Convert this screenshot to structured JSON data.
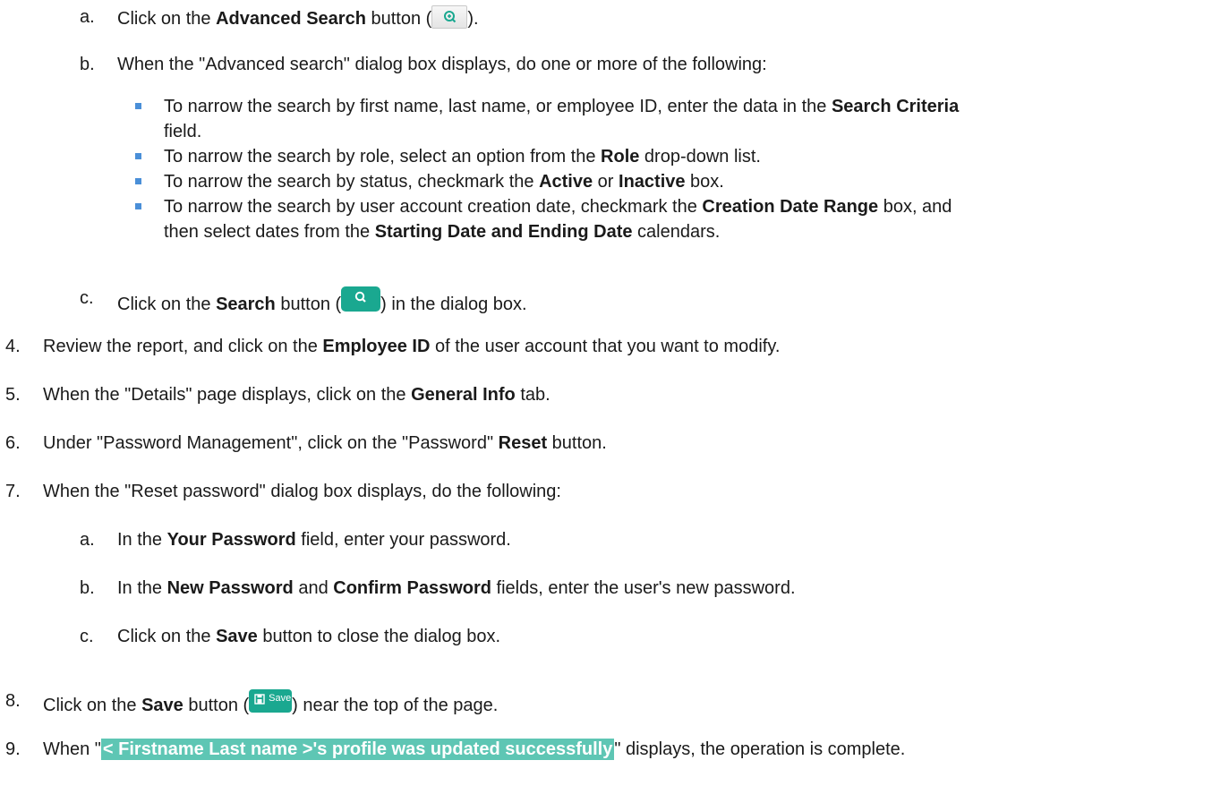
{
  "steps": {
    "a_top": {
      "marker": "a.",
      "pre": "Click on the ",
      "bold": "Advanced Search",
      "mid": " button (",
      "post": ").",
      "icon": "zoom-in-icon"
    },
    "b_top": {
      "marker": "b.",
      "text": "When the \"Advanced search\" dialog box displays, do one or more of the following:",
      "bullets": [
        {
          "pre": "To narrow the search by first name, last name, or employee ID, enter the data in the ",
          "bold1": "Search Criteria",
          "cont": "field."
        },
        {
          "pre": "To narrow the search by role, select an option from the ",
          "bold1": "Role",
          "post": " drop-down list."
        },
        {
          "pre": "To narrow the search by status, checkmark the ",
          "bold1": "Active",
          "mid": " or ",
          "bold2": "Inactive",
          "post": " box."
        },
        {
          "pre": "To narrow the search by user account creation date, checkmark the ",
          "bold1": "Creation Date Range",
          "post": " box, and",
          "cont_pre": "then select dates from the ",
          "cont_bold": "Starting Date and Ending Date",
          "cont_post": " calendars."
        }
      ]
    },
    "c_top": {
      "marker": "c.",
      "pre": "Click on the ",
      "bold": "Search",
      "mid": " button (",
      "post": ") in the dialog box.",
      "icon": "search-icon"
    },
    "s4": {
      "marker": "4.",
      "pre": "Review the report, and click on the ",
      "bold": "Employee ID",
      "post": " of the user account that you want to modify."
    },
    "s5": {
      "marker": "5.",
      "pre": "When the \"Details\" page displays, click on the ",
      "bold": "General Info",
      "post": " tab."
    },
    "s6": {
      "marker": "6.",
      "pre": "Under \"Password Management\", click on the \"Password\" ",
      "bold": "Reset",
      "post": " button."
    },
    "s7": {
      "marker": "7.",
      "text": "When the \"Reset password\" dialog box displays, do the following:",
      "a": {
        "marker": "a.",
        "pre": "In the ",
        "bold": "Your Password",
        "post": " field, enter your password."
      },
      "b": {
        "marker": "b.",
        "pre": "In the ",
        "bold1": "New Password",
        "mid": " and ",
        "bold2": "Confirm Password",
        "post": " fields, enter the user's new password."
      },
      "c": {
        "marker": "c.",
        "pre": "Click on the ",
        "bold": "Save",
        "post": " button to close the dialog box."
      }
    },
    "s8": {
      "marker": "8.",
      "pre": "Click on the ",
      "bold": "Save",
      "mid": " button (",
      "post": ") near the top of the page.",
      "button_label": "Save",
      "icon": "floppy-disk-icon"
    },
    "s9": {
      "marker": "9.",
      "pre": "When \"",
      "highlight": "< Firstname Last name >'s profile was updated successfully",
      "post": "\" displays, the operation is complete."
    }
  },
  "colors": {
    "accent": "#1aa890",
    "highlight": "#5ec6b4",
    "bullet": "#4a8fd8"
  }
}
